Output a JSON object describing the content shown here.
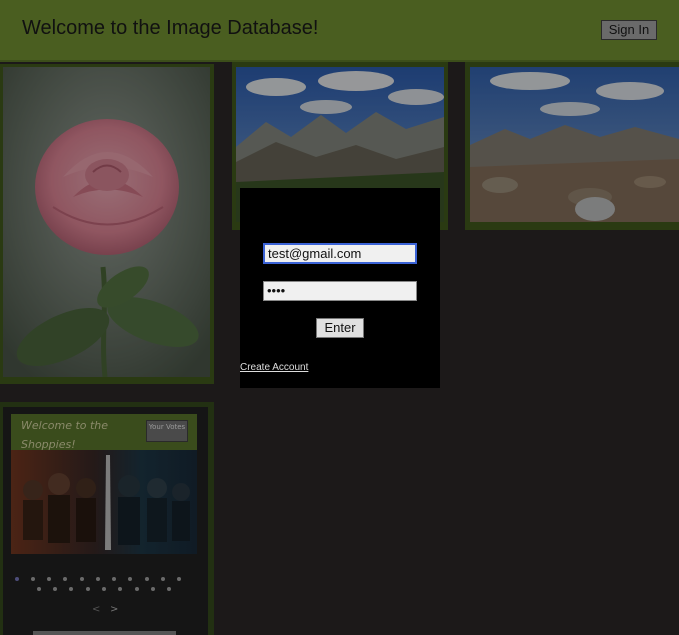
{
  "header": {
    "title": "Welcome to the Image Database!",
    "sign_in_label": "Sign In"
  },
  "login": {
    "email_value": "test@gmail.com",
    "password_value": "••••",
    "enter_label": "Enter",
    "create_account_label": "Create Account"
  },
  "carousel": {
    "header_title": "Welcome to the Shoppies!",
    "votes_label": "Your Votes",
    "prev_label": "<",
    "next_label": ">"
  },
  "colors": {
    "header": "#4a5e20",
    "background": "#1c1919",
    "card": "#2a3a12",
    "modal": "#000000",
    "focus": "#3b63d6"
  },
  "images": [
    {
      "subject": "pink rose"
    },
    {
      "subject": "mountain landscape"
    },
    {
      "subject": "rocky mountain landscape"
    },
    {
      "subject": "movie poster collage"
    }
  ]
}
